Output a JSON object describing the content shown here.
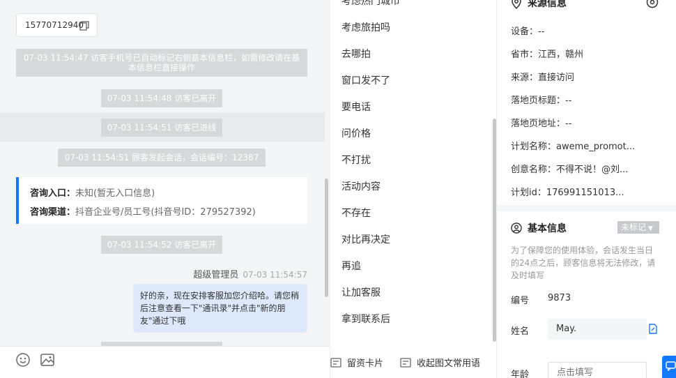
{
  "chat": {
    "phone_number": "15770712940",
    "system_messages": {
      "auto_mark": "07-03 11:54:47 访客手机号已自动标记右侧基本信息栏，如需修改请在基本信息栏直接操作",
      "left1": "07-03 11:54:48 访客已离开",
      "entered": "07-03 11:54:51 访客已进线",
      "session": "07-03 11:54:51 顾客发起会话，会话编号：12387",
      "left2": "07-03 11:54:52 访客已离开"
    },
    "info_card": {
      "entry_label": "咨询入口：",
      "entry_value": "未知(暂无入口信息)",
      "channel_label": "咨询渠道：",
      "channel_value": "抖音企业号/员工号(抖音号ID：279527392)"
    },
    "agent_name": "超级管理员",
    "agent_time": "07-03 11:54:57",
    "agent_message": "好的亲，现在安排客服加您介绍哈。请您稍后注意查看一下\"通讯录\"并点击\"新的朋友\"通过下哦",
    "toolbar": {
      "emoji_icon": "emoji-icon",
      "image_icon": "image-icon"
    }
  },
  "tags": {
    "items": [
      "考虑热门城市",
      "考虑旅拍吗",
      "去哪拍",
      "窗口发不了",
      "要电话",
      "问价格",
      "不打扰",
      "活动内容",
      "不存在",
      "对比再决定",
      "再追",
      "让加客服",
      "拿到联系后"
    ],
    "footer": {
      "lead_card": "留资卡片",
      "collapse": "收起图文常用语"
    }
  },
  "source_info": {
    "title": "来源信息",
    "device": "设备：--",
    "province": "省市：江西，赣州",
    "source": "来源：直接访问",
    "landing_title": "落地页标题：--",
    "landing_url": "落地页地址：--",
    "plan_name": "计划名称：aweme_promot...",
    "creative_name": "创意名称：不得不说！@刘...",
    "plan_id": "计划id：176991151013..."
  },
  "basic_info": {
    "title": "基本信息",
    "tag_status": "未标记",
    "notice": "为了保障您的使用体验，会话发生当日的24点之后，顾客信息将无法修改，请及时填写",
    "id_label": "编号",
    "id_value": "9873",
    "name_label": "姓名",
    "name_value": "May.",
    "age_label": "年龄",
    "age_placeholder": "点击填写"
  },
  "colors": {
    "accent": "#1677ff",
    "system_msg_bg": "#d7d8da",
    "bubble_bg": "#dde9fb"
  }
}
